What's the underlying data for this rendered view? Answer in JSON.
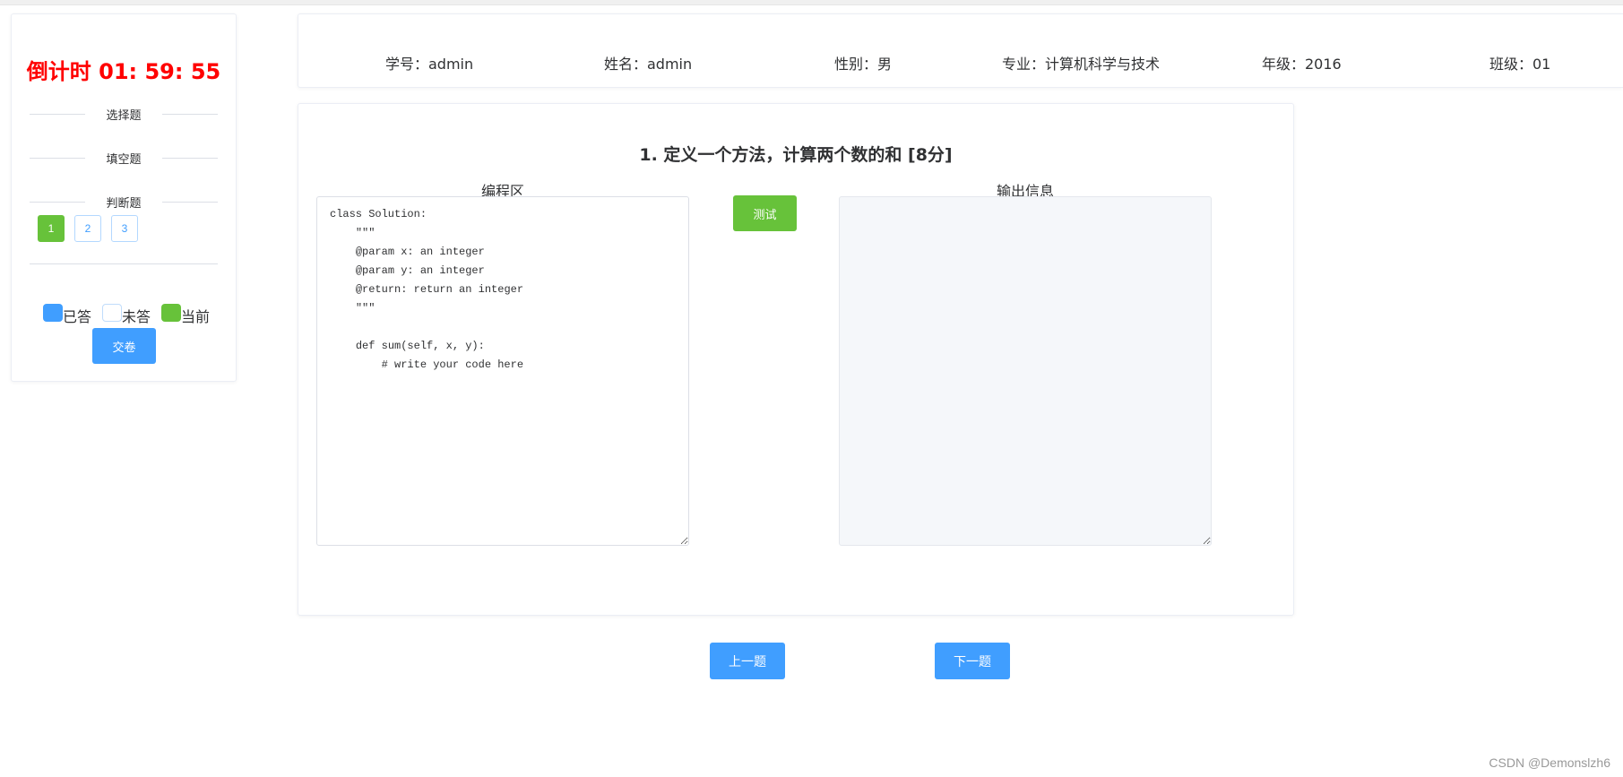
{
  "sidebar": {
    "countdown": "倒计时 01: 59: 55",
    "sections": [
      "选择题",
      "填空题",
      "判断题"
    ],
    "question_numbers": [
      "1",
      "2",
      "3"
    ],
    "current_question": "1",
    "legend": {
      "answered": "已答",
      "unanswered": "未答",
      "current": "当前"
    },
    "submit_label": "交卷"
  },
  "student_info": {
    "student_id": "学号：admin",
    "name": "姓名：admin",
    "gender": "性别：男",
    "major": "专业：计算机科学与技术",
    "grade": "年级：2016",
    "class": "班级：01"
  },
  "question": {
    "title": "1. 定义一个方法，计算两个数的和 [8分]",
    "code_label": "编程区",
    "output_label": "输出信息",
    "test_label": "测试",
    "code": "class Solution:\n    \"\"\"\n    @param x: an integer\n    @param y: an integer\n    @return: return an integer\n    \"\"\"\n\n    def sum(self, x, y):\n        # write your code here",
    "output": ""
  },
  "navigation": {
    "prev_label": "上一题",
    "next_label": "下一题"
  },
  "watermark": "CSDN @Demonslzh6",
  "colors": {
    "primary": "#409eff",
    "success": "#67c23a",
    "countdown": "#ff0000"
  }
}
